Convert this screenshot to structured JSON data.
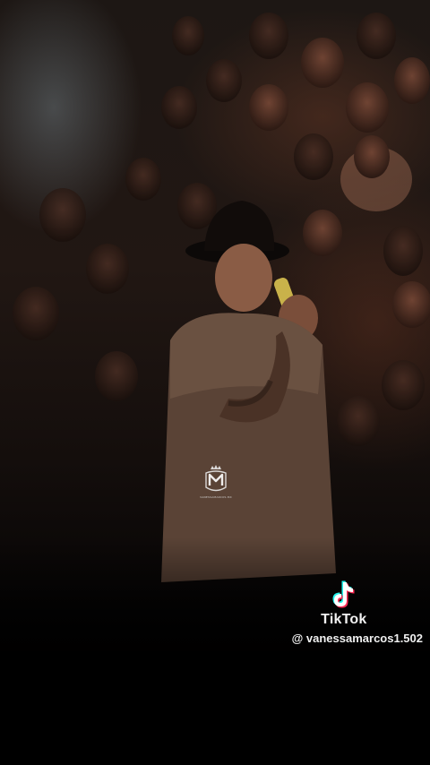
{
  "video": {
    "description_icon": "concert-singer-photo"
  },
  "watermark": {
    "logo_icon": "crown-m-monogram-icon",
    "caption": "VANESSAMARCOS.MX"
  },
  "tiktok": {
    "logo_icon": "tiktok-note-icon",
    "brand": "TikTok",
    "handle": "@ vanessamarcos1.502",
    "colors": {
      "cyan": "#25f4ee",
      "red": "#fe2c55",
      "white": "#ffffff"
    }
  }
}
